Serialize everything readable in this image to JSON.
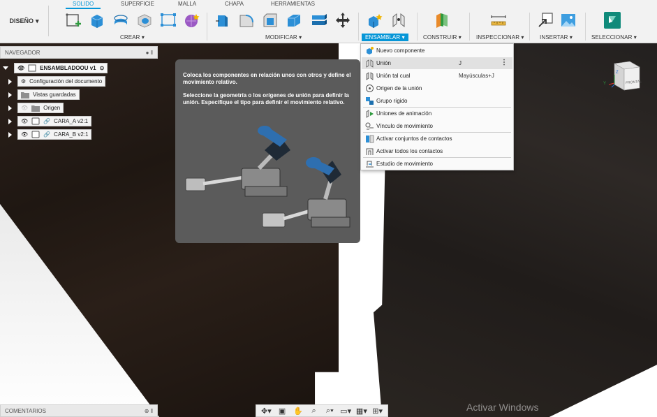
{
  "toolbar": {
    "design_label": "DISEÑO",
    "tabs": [
      "SOLIDO",
      "SUPERFICIE",
      "MALLA",
      "CHAPA",
      "HERRAMIENTAS"
    ],
    "active_tab": "SOLIDO",
    "groups": {
      "crear": "CREAR",
      "modificar": "MODIFICAR",
      "ensamblar": "ENSAMBLAR",
      "construir": "CONSTRUIR",
      "inspeccionar": "INSPECCIONAR",
      "insertar": "INSERTAR",
      "seleccionar": "SELECCIONAR"
    },
    "accent_color": "#0696d7"
  },
  "navigator": {
    "title": "NAVEGADOR",
    "root": "ENSAMBLADOOU v1",
    "items": [
      {
        "label": "Configuración del documento",
        "icon": "gear-icon"
      },
      {
        "label": "Vistas guardadas",
        "icon": "folder-icon"
      },
      {
        "label": "Origen",
        "icon": "folder-icon"
      },
      {
        "label": "CARA_A v2:1",
        "icon": "link-icon"
      },
      {
        "label": "CARA_B v2:1",
        "icon": "link-icon"
      }
    ]
  },
  "tooltip": {
    "paragraph1": "Coloca los componentes en relación unos con otros y define el movimiento relativo.",
    "paragraph2": "Seleccione la geometría o los orígenes de unión para definir la unión. Especifique el tipo para definir el movimiento relativo."
  },
  "menu": {
    "items": [
      {
        "label": "Nuevo componente",
        "shortcut": "",
        "icon": "new-component-icon"
      },
      {
        "label": "Unión",
        "shortcut": "J",
        "icon": "joint-icon"
      },
      {
        "label": "Unión tal cual",
        "shortcut": "Mayúsculas+J",
        "icon": "as-built-joint-icon"
      },
      {
        "label": "Origen de la unión",
        "shortcut": "",
        "icon": "joint-origin-icon"
      },
      {
        "label": "Grupo rígido",
        "shortcut": "",
        "icon": "rigid-group-icon"
      },
      {
        "label": "Uniones de animación",
        "shortcut": "",
        "icon": "animate-joints-icon"
      },
      {
        "label": "Vínculo de movimiento",
        "shortcut": "",
        "icon": "motion-link-icon"
      },
      {
        "label": "Activar conjuntos de contactos",
        "shortcut": "",
        "icon": "contact-sets-icon"
      },
      {
        "label": "Activar todos los contactos",
        "shortcut": "",
        "icon": "all-contacts-icon"
      },
      {
        "label": "Estudio de movimiento",
        "shortcut": "",
        "icon": "motion-study-icon"
      }
    ]
  },
  "viewcube": {
    "face": "FRONTAL"
  },
  "comments": {
    "title": "COMENTARIOS"
  },
  "watermark": "Activar Windows"
}
